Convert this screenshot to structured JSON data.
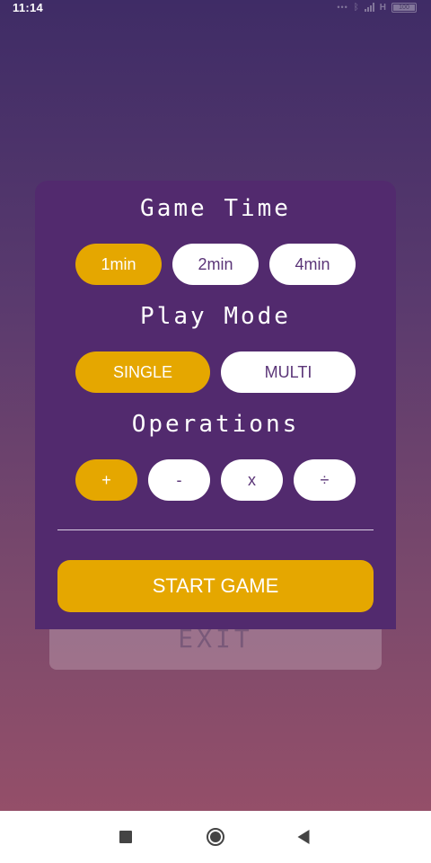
{
  "status_bar": {
    "time": "11:14",
    "network": "H",
    "battery": "100",
    "icons": [
      "more-dots-icon",
      "bluetooth-icon",
      "signal-icon",
      "battery-icon"
    ]
  },
  "background_exit": {
    "label": "EXIT"
  },
  "dialog": {
    "game_time": {
      "title": "Game Time",
      "options": [
        "1min",
        "2min",
        "4min"
      ],
      "selected": "1min"
    },
    "play_mode": {
      "title": "Play Mode",
      "options": [
        "SINGLE",
        "MULTI"
      ],
      "selected": "SINGLE"
    },
    "operations": {
      "title": "Operations",
      "options": [
        "+",
        "-",
        "x",
        "÷"
      ],
      "selected": "+"
    },
    "start_label": "START GAME"
  },
  "colors": {
    "accent": "#e5a700",
    "dialog_bg": "#522a6e",
    "option_text": "#5b3578"
  },
  "nav_bar": {
    "icons": [
      "recents-square-icon",
      "home-circle-icon",
      "back-triangle-icon"
    ]
  }
}
